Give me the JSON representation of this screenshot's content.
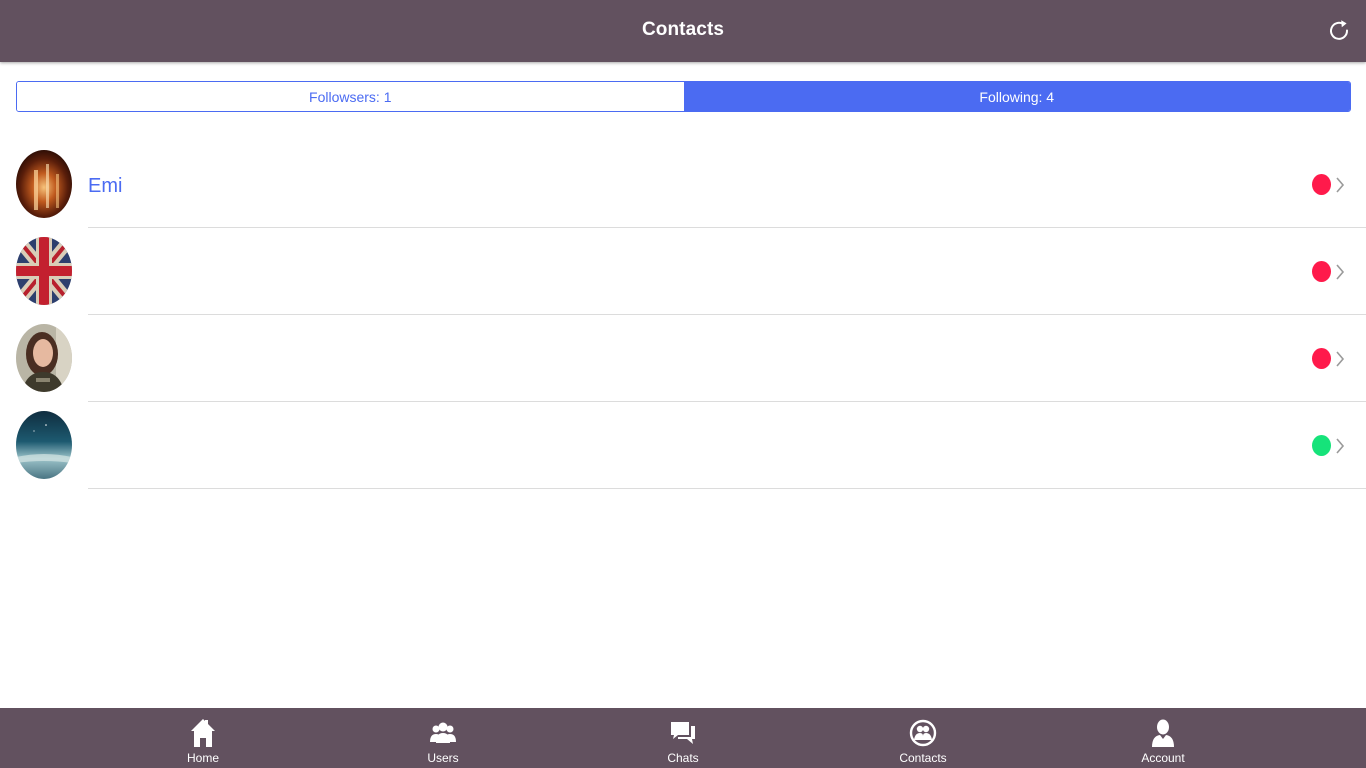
{
  "header": {
    "title": "Contacts",
    "refresh_icon": "refresh-icon"
  },
  "segments": {
    "followers_label": "Followsers: 1",
    "following_label": "Following: 4",
    "active": "following"
  },
  "contacts": [
    {
      "name": "Emi",
      "avatar": "fire-photo",
      "status": "offline",
      "status_color": "#ff1a4b"
    },
    {
      "name": "",
      "avatar": "union-jack-flag",
      "status": "offline",
      "status_color": "#ff1a4b"
    },
    {
      "name": "",
      "avatar": "girl-portrait-photo",
      "status": "offline",
      "status_color": "#ff1a4b"
    },
    {
      "name": "",
      "avatar": "sky-landscape-photo",
      "status": "online",
      "status_color": "#16e37a"
    }
  ],
  "tabs": [
    {
      "label": "Home",
      "icon": "home-icon"
    },
    {
      "label": "Users",
      "icon": "users-icon"
    },
    {
      "label": "Chats",
      "icon": "chats-icon"
    },
    {
      "label": "Contacts",
      "icon": "contacts-icon"
    },
    {
      "label": "Account",
      "icon": "account-icon"
    }
  ],
  "colors": {
    "bar": "#62515f",
    "accent": "#4b6bf2",
    "offline": "#ff1a4b",
    "online": "#16e37a"
  }
}
